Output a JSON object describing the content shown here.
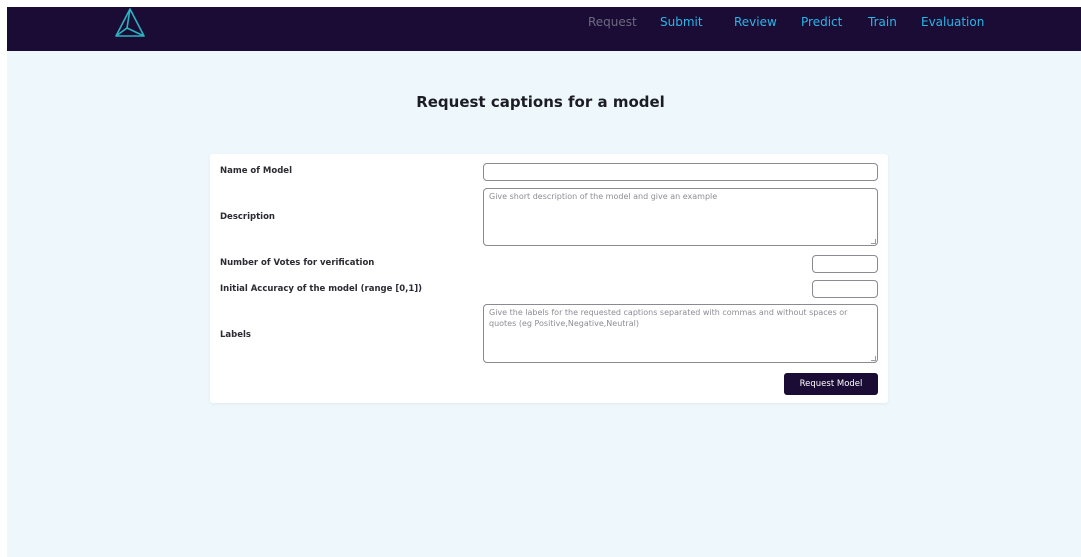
{
  "nav": {
    "items": [
      {
        "label": "Request"
      },
      {
        "label": "Submit"
      },
      {
        "label": "Review"
      },
      {
        "label": "Predict"
      },
      {
        "label": "Train"
      },
      {
        "label": "Evaluation"
      }
    ]
  },
  "colors": {
    "navbar": "#1a0c35",
    "active_link": "#29b6e8",
    "muted_link": "#6d6a80",
    "background": "#eef8fc",
    "logo": "#2bb3c0"
  },
  "logo": {
    "icon": "triangle-logo-icon"
  },
  "page": {
    "title": "Request captions for a model"
  },
  "form": {
    "name_label": "Name of Model",
    "name_value": "",
    "description_label": "Description",
    "description_placeholder": "Give short description of the model and give an example",
    "votes_label": "Number of Votes for verification",
    "votes_value": "",
    "accuracy_label": "Initial Accuracy of the model (range [0,1])",
    "accuracy_value": "",
    "labels_label": "Labels",
    "labels_placeholder": "Give the labels for the requested captions separated with commas and without spaces or quotes (eg Positive,Negative,Neutral)",
    "submit_label": "Request Model"
  }
}
